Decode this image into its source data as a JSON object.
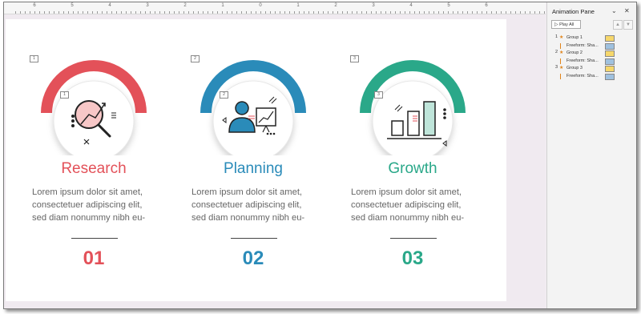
{
  "ruler": {
    "labels": [
      "6",
      "5",
      "4",
      "3",
      "2",
      "1",
      "0",
      "1",
      "2",
      "3",
      "4",
      "5",
      "6"
    ]
  },
  "slide": {
    "columns": [
      {
        "anim_number": "1",
        "inner_anim_number": "1",
        "title": "Research",
        "body": "Lorem ipsum dolor sit amet,\nconsectetuer adipiscing elit,\nsed diam nonummy nibh eu-",
        "number": "01",
        "color": "#e35159",
        "icon": "magnifier-chart-icon"
      },
      {
        "anim_number": "2",
        "inner_anim_number": "2",
        "title": "Planning",
        "body": "Lorem ipsum dolor sit amet,\nconsectetuer adipiscing elit,\nsed diam nonummy nibh eu-",
        "number": "02",
        "color": "#2a8bb9",
        "icon": "presenter-board-icon"
      },
      {
        "anim_number": "3",
        "inner_anim_number": "3",
        "title": "Growth",
        "body": "Lorem ipsum dolor sit amet,\nconsectetuer adipiscing elit,\nsed diam nonummy nibh eu-",
        "number": "03",
        "color": "#2aa889",
        "icon": "bar-growth-icon"
      }
    ]
  },
  "animation_pane": {
    "title": "Animation Pane",
    "play_all": "Play All",
    "items": [
      {
        "index": "1",
        "label": "Group 1",
        "type": "group",
        "swatch": "#f6d76b"
      },
      {
        "index": "",
        "label": "Freeform: Sha...",
        "type": "sub",
        "swatch": "#9fc1df"
      },
      {
        "index": "2",
        "label": "Group 2",
        "type": "group",
        "swatch": "#f6d76b"
      },
      {
        "index": "",
        "label": "Freeform: Sha...",
        "type": "sub",
        "swatch": "#9fc1df"
      },
      {
        "index": "3",
        "label": "Group 3",
        "type": "group",
        "swatch": "#f6d76b"
      },
      {
        "index": "",
        "label": "Freeform: Sha...",
        "type": "sub",
        "swatch": "#9fc1df"
      }
    ]
  }
}
